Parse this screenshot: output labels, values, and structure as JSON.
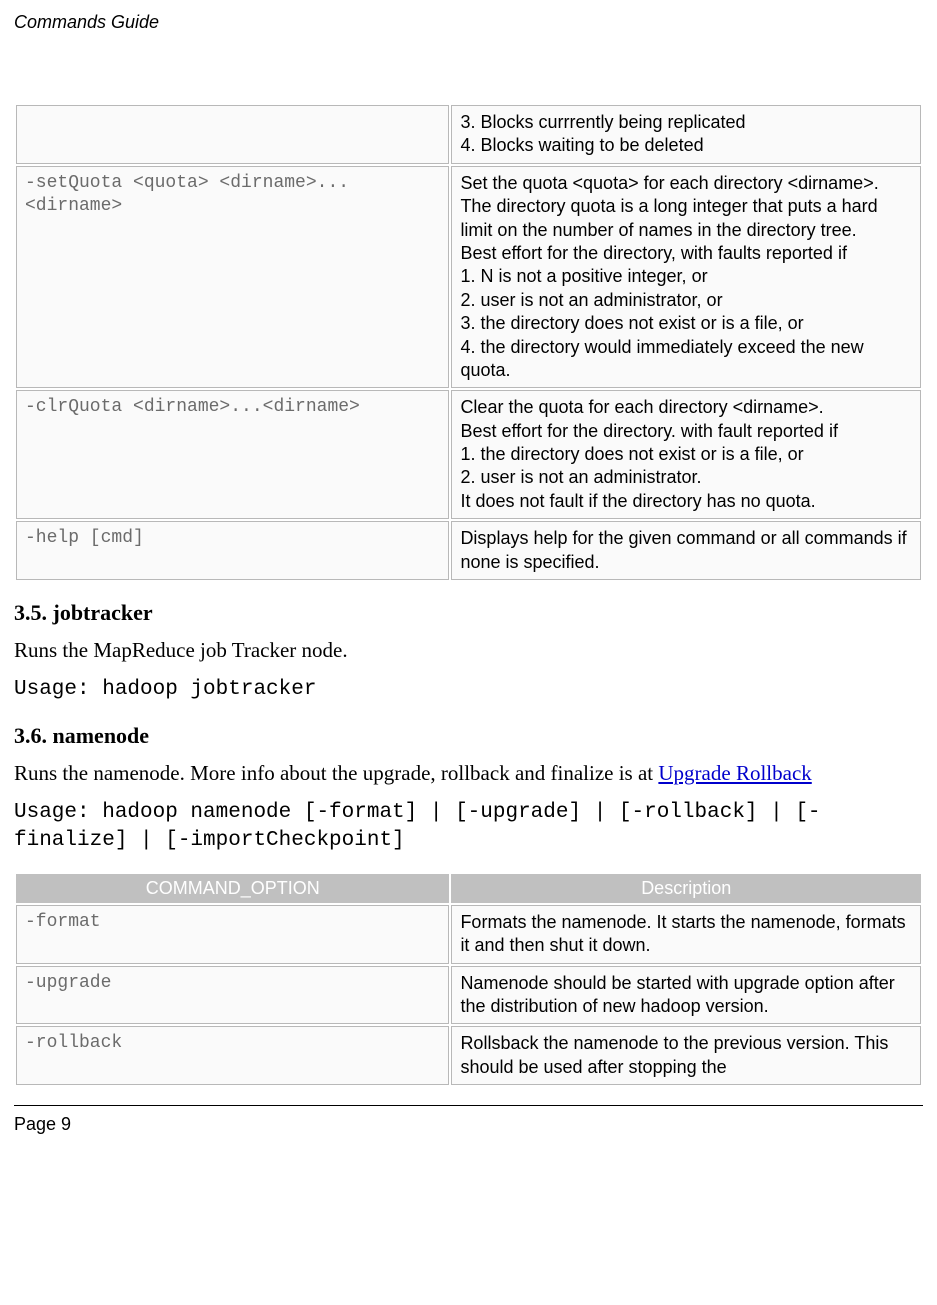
{
  "header": {
    "title": "Commands Guide"
  },
  "table1": {
    "rows": [
      {
        "cmd": "",
        "desc": "3. Blocks currrently being replicated\n4. Blocks waiting to be deleted"
      },
      {
        "cmd": "-setQuota <quota> <dirname>...<dirname>",
        "desc": "Set the quota <quota> for each directory <dirname>. The directory quota is a long integer that puts a hard limit on the number of names in the directory tree.\nBest effort for the directory, with faults reported if\n1. N is not a positive integer, or\n2. user is not an administrator, or\n3. the directory does not exist or is a file, or\n4. the directory would immediately exceed the new quota."
      },
      {
        "cmd": "-clrQuota <dirname>...<dirname>",
        "desc": "Clear the quota for each directory <dirname>.\nBest effort for the directory. with fault reported if\n1. the directory does not exist or is a file, or\n2. user is not an administrator.\nIt does not fault if the directory has no quota."
      },
      {
        "cmd": "-help [cmd]",
        "desc": "Displays help for the given command or all commands if none is specified."
      }
    ]
  },
  "section_jobtracker": {
    "heading": "3.5. jobtracker",
    "body": "Runs the MapReduce job Tracker node.",
    "usage": "Usage: hadoop jobtracker"
  },
  "section_namenode": {
    "heading": "3.6. namenode",
    "body_pre": "Runs the namenode. More info about the upgrade, rollback and finalize is at ",
    "link": "Upgrade Rollback",
    "usage": "Usage: hadoop namenode [-format] | [-upgrade] | [-rollback] | [-finalize] | [-importCheckpoint]"
  },
  "table2": {
    "head": {
      "c1": "COMMAND_OPTION",
      "c2": "Description"
    },
    "rows": [
      {
        "cmd": "-format",
        "desc": "Formats the namenode. It starts the namenode, formats it and then shut it down."
      },
      {
        "cmd": "-upgrade",
        "desc": "Namenode should be started with upgrade option after the distribution of new hadoop version."
      },
      {
        "cmd": "-rollback",
        "desc": "Rollsback the namenode to the previous version. This should be used after stopping the"
      }
    ]
  },
  "footer": {
    "page": "Page 9"
  }
}
